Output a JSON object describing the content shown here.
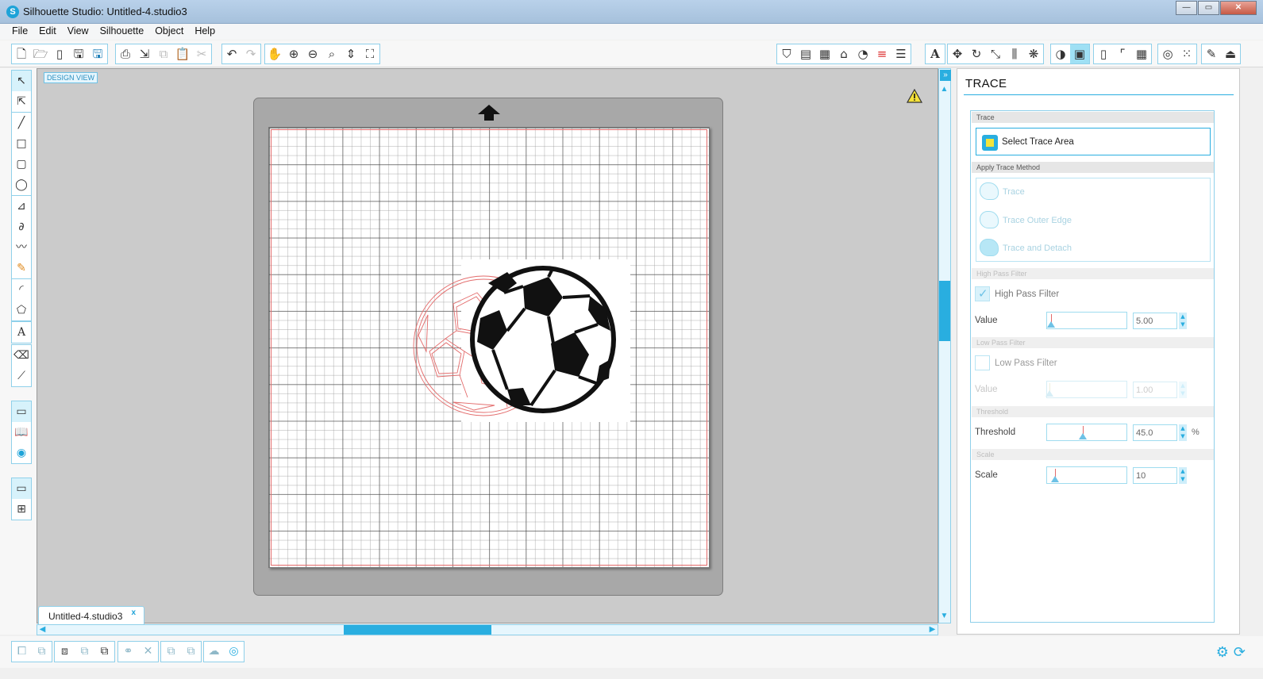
{
  "window": {
    "title": "Silhouette Studio: Untitled-4.studio3",
    "app_icon": "S"
  },
  "window_controls": {
    "minimize": "—",
    "maximize": "▭",
    "close": "✕"
  },
  "menu": [
    "File",
    "Edit",
    "View",
    "Silhouette",
    "Object",
    "Help"
  ],
  "toolbar_icons": {
    "file": [
      "new-file-icon",
      "open-file-icon",
      "open-library-icon",
      "save-icon",
      "save-to-library-icon"
    ],
    "edit": [
      "print-icon",
      "send-to-cutter-icon",
      "copy-icon",
      "paste-icon",
      "cut-icon"
    ],
    "history": [
      "undo-icon",
      "redo-icon"
    ],
    "zoom": [
      "pan-icon",
      "zoom-in-icon",
      "zoom-out-icon",
      "zoom-select-icon",
      "fit-to-page-icon",
      "zoom-all-icon"
    ]
  },
  "design_view_label": "DESIGN VIEW",
  "document_tab": {
    "name": "Untitled-4.studio3",
    "close": "x"
  },
  "panel": {
    "title": "TRACE",
    "sections": {
      "trace": "Trace",
      "apply_method": "Apply Trace Method",
      "high_pass": "High Pass Filter",
      "low_pass": "Low Pass Filter",
      "threshold": "Threshold",
      "scale": "Scale"
    },
    "select_trace_area": "Select Trace Area",
    "methods": [
      "Trace",
      "Trace Outer Edge",
      "Trace and Detach"
    ],
    "high_pass_filter": {
      "label": "High Pass Filter",
      "checked": true,
      "value_label": "Value",
      "value": "5.00",
      "slider_fraction": 0.05
    },
    "low_pass_filter": {
      "label": "Low Pass Filter",
      "checked": false,
      "value_label": "Value",
      "value": "1.00",
      "slider_fraction": 0.03
    },
    "threshold": {
      "label": "Threshold",
      "value": "45.0",
      "unit": "%",
      "slider_fraction": 0.45
    },
    "scale": {
      "label": "Scale",
      "value": "10",
      "slider_fraction": 0.1
    }
  },
  "colors": {
    "accent": "#29aee0",
    "cut_line": "#e36b6b",
    "mat_gray": "#a8a8a8"
  }
}
